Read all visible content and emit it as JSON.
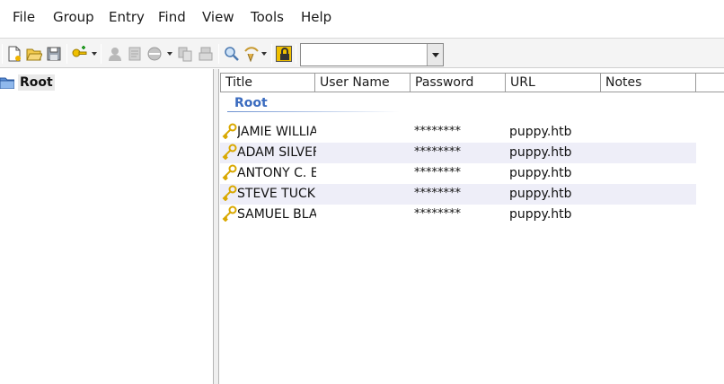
{
  "menu": [
    "File",
    "Group",
    "Entry",
    "Find",
    "View",
    "Tools",
    "Help"
  ],
  "toolbar": {
    "search": {
      "value": "",
      "placeholder": ""
    },
    "icons": [
      "new-database-icon",
      "open-database-icon",
      "save-database-icon",
      "add-entry-icon",
      "add-user-icon",
      "edit-entry-icon",
      "delete-entry-icon",
      "copy-username-icon",
      "copy-password-icon",
      "find-icon",
      "tools-icon",
      "lock-workspace-icon"
    ]
  },
  "tree": {
    "root_label": "Root"
  },
  "columns": [
    "Title",
    "User Name",
    "Password",
    "URL",
    "Notes"
  ],
  "group_header": "Root",
  "entries": [
    {
      "title": "JAMIE WILLIA",
      "username": "",
      "password": "********",
      "url": "puppy.htb",
      "notes": ""
    },
    {
      "title": "ADAM SILVEF",
      "username": "",
      "password": "********",
      "url": "puppy.htb",
      "notes": ""
    },
    {
      "title": "ANTONY C. E",
      "username": "",
      "password": "********",
      "url": "puppy.htb",
      "notes": ""
    },
    {
      "title": "STEVE TUCKE",
      "username": "",
      "password": "********",
      "url": "puppy.htb",
      "notes": ""
    },
    {
      "title": "SAMUEL BLAI",
      "username": "",
      "password": "********",
      "url": "puppy.htb",
      "notes": ""
    }
  ],
  "colors": {
    "group_label": "#3a6bbf",
    "alt_row": "#eeeef8",
    "key_icon": "#e6b800"
  }
}
